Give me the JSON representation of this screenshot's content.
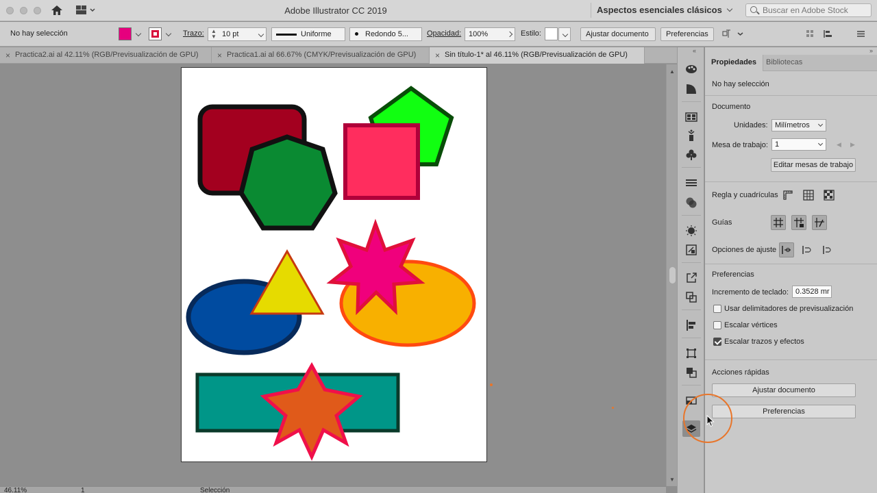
{
  "app": {
    "window_title": "Adobe Illustrator CC 2019",
    "workspace": "Aspectos esenciales clásicos",
    "search_placeholder": "Buscar en Adobe Stock"
  },
  "control_bar": {
    "selection_status": "No hay selección",
    "fill_color": "#e6007e",
    "stroke_color": "#d8103c",
    "stroke_label": "Trazo:",
    "stroke_weight": "10 pt",
    "profile": "Uniforme",
    "brush": "Redondo 5...",
    "opacity_label": "Opacidad:",
    "opacity_value": "100%",
    "style_label": "Estilo:",
    "adjust_button": "Ajustar documento",
    "preferences_button": "Preferencias"
  },
  "tabs": [
    {
      "label": "Practica2.ai al 42.11% (RGB/Previsualización de GPU)",
      "active": false
    },
    {
      "label": "Practica1.ai al 66.67% (CMYK/Previsualización de GPU)",
      "active": false
    },
    {
      "label": "Sin título-1* al 46.11% (RGB/Previsualización de GPU)",
      "active": true
    }
  ],
  "status_bar": {
    "zoom": "46.11%",
    "artboard_number": "1",
    "tool_name": "Selección"
  },
  "panel": {
    "tabs": [
      {
        "label": "Propiedades",
        "active": true
      },
      {
        "label": "Bibliotecas",
        "active": false
      }
    ],
    "no_selection": "No hay selección",
    "document_heading": "Documento",
    "units_label": "Unidades:",
    "units_value": "Milímetros",
    "artboard_label": "Mesa de trabajo:",
    "artboard_value": "1",
    "edit_artboards_button": "Editar mesas de trabajo",
    "rulers_label": "Regla y cuadrículas",
    "guides_label": "Guías",
    "snap_label": "Opciones de ajuste",
    "prefs_heading": "Preferencias",
    "keyboard_increment_label": "Incremento de teclado:",
    "keyboard_increment_value": "0.3528 mr",
    "checkboxes": [
      {
        "label": "Usar delimitadores de previsualización",
        "checked": false
      },
      {
        "label": "Escalar vértices",
        "checked": false
      },
      {
        "label": "Escalar trazos y efectos",
        "checked": true
      }
    ],
    "quick_actions_heading": "Acciones rápidas",
    "quick_adjust_button": "Ajustar documento",
    "quick_prefs_button": "Preferencias"
  },
  "strip_icons": [
    "color-guide-icon",
    "gradient-icon",
    "swatch-libraries-icon",
    "symbols-sprayer-icon",
    "clubs-symbol-icon",
    "stroke-lines-icon",
    "transparency-icon",
    "appearance-icon",
    "graphic-styles-icon",
    "export-icon",
    "artboards-icon",
    "align-icon",
    "transform-icon",
    "pathfinder-icon",
    "image-trace-icon",
    "layers-icon"
  ],
  "artwork": {
    "rounded_rect_fill": "#a3001f",
    "heptagon_fill": "#0a8a32",
    "pentagon_fill": "#11ff11",
    "square_fill": "#ff2d5e",
    "ellipse_blue_fill": "#004ba0",
    "triangle_fill": "#e6db00",
    "ellipse_orange_fill": "#f8b000",
    "star8_fill": "#f0007c",
    "rect_teal_fill": "#009688",
    "star7_fill": "#e05a1a"
  }
}
